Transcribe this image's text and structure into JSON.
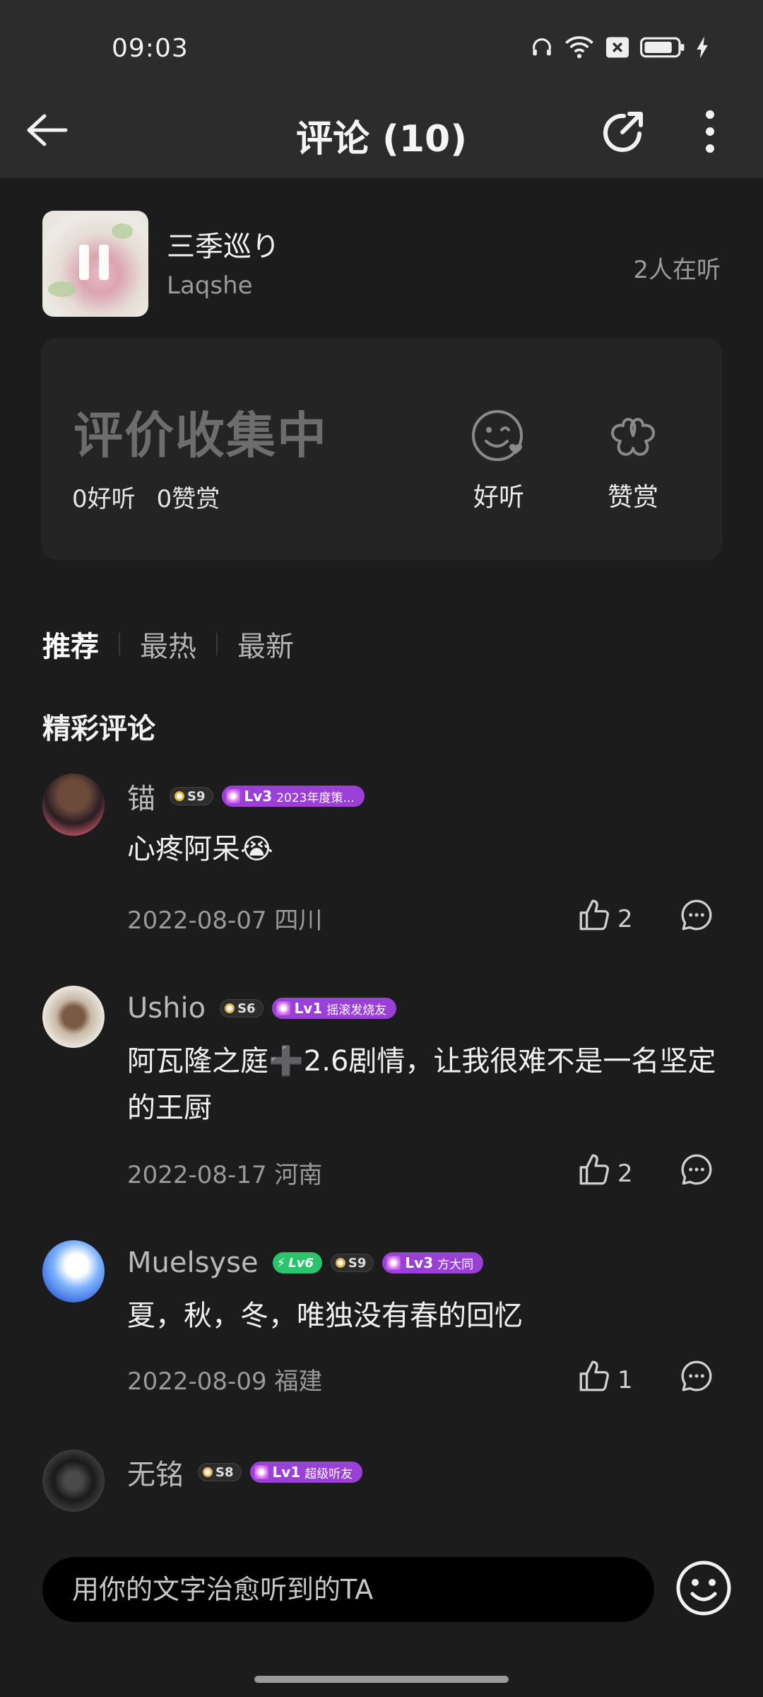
{
  "status_bar": {
    "time": "09:03",
    "icons": [
      "headphones-icon",
      "wifi-icon",
      "sim-off-icon",
      "battery-icon",
      "charging-icon"
    ]
  },
  "header": {
    "title": "评论 (10)",
    "back_icon": "arrow-left-icon",
    "share_icon": "share-icon",
    "more_icon": "more-vertical-icon"
  },
  "song": {
    "title": "三季巡り",
    "artist": "Laqshe",
    "listening": "2人在听",
    "cover_state_icon": "pause-icon"
  },
  "rating": {
    "status": "评价收集中",
    "good_count": "0好听",
    "reward_count": "0赞赏",
    "good_label": "好听",
    "reward_label": "赞赏"
  },
  "sort_tabs": [
    "推荐",
    "最热",
    "最新"
  ],
  "active_sort_tab": "推荐",
  "section_title": "精彩评论",
  "comments": [
    {
      "name": "锚",
      "badges": {
        "s": "S9",
        "lv": "Lv3",
        "lv_text": "2023年度策..."
      },
      "text": "心疼阿呆😭",
      "meta": "2022-08-07 四川",
      "likes": "2"
    },
    {
      "name": "Ushio",
      "badges": {
        "s": "S6",
        "lv": "Lv1",
        "lv_text": "摇滚发烧友"
      },
      "text": "阿瓦隆之庭➕2.6剧情，让我很难不是一名坚定的王厨",
      "meta": "2022-08-17 河南",
      "likes": "2"
    },
    {
      "name": "Muelsyse",
      "badges": {
        "green": "Lv6",
        "s": "S9",
        "lv": "Lv3",
        "lv_text": "方大同"
      },
      "text": "夏，秋，冬，唯独没有春的回忆",
      "meta": "2022-08-09 福建",
      "likes": "1"
    },
    {
      "name": "无铭",
      "badges": {
        "s": "S8",
        "lv": "Lv1",
        "lv_text": "超级听友"
      },
      "text": "",
      "meta": "",
      "likes": ""
    }
  ],
  "input": {
    "placeholder": "用你的文字治愈听到的TA",
    "emoji_icon": "emoji-smile-icon"
  },
  "colors": {
    "background": "#1c1c1c",
    "top_bar": "#2c2c2c",
    "card": "#242424",
    "level_badge": "#9b40d6",
    "vip_badge": "#2bc46a"
  }
}
